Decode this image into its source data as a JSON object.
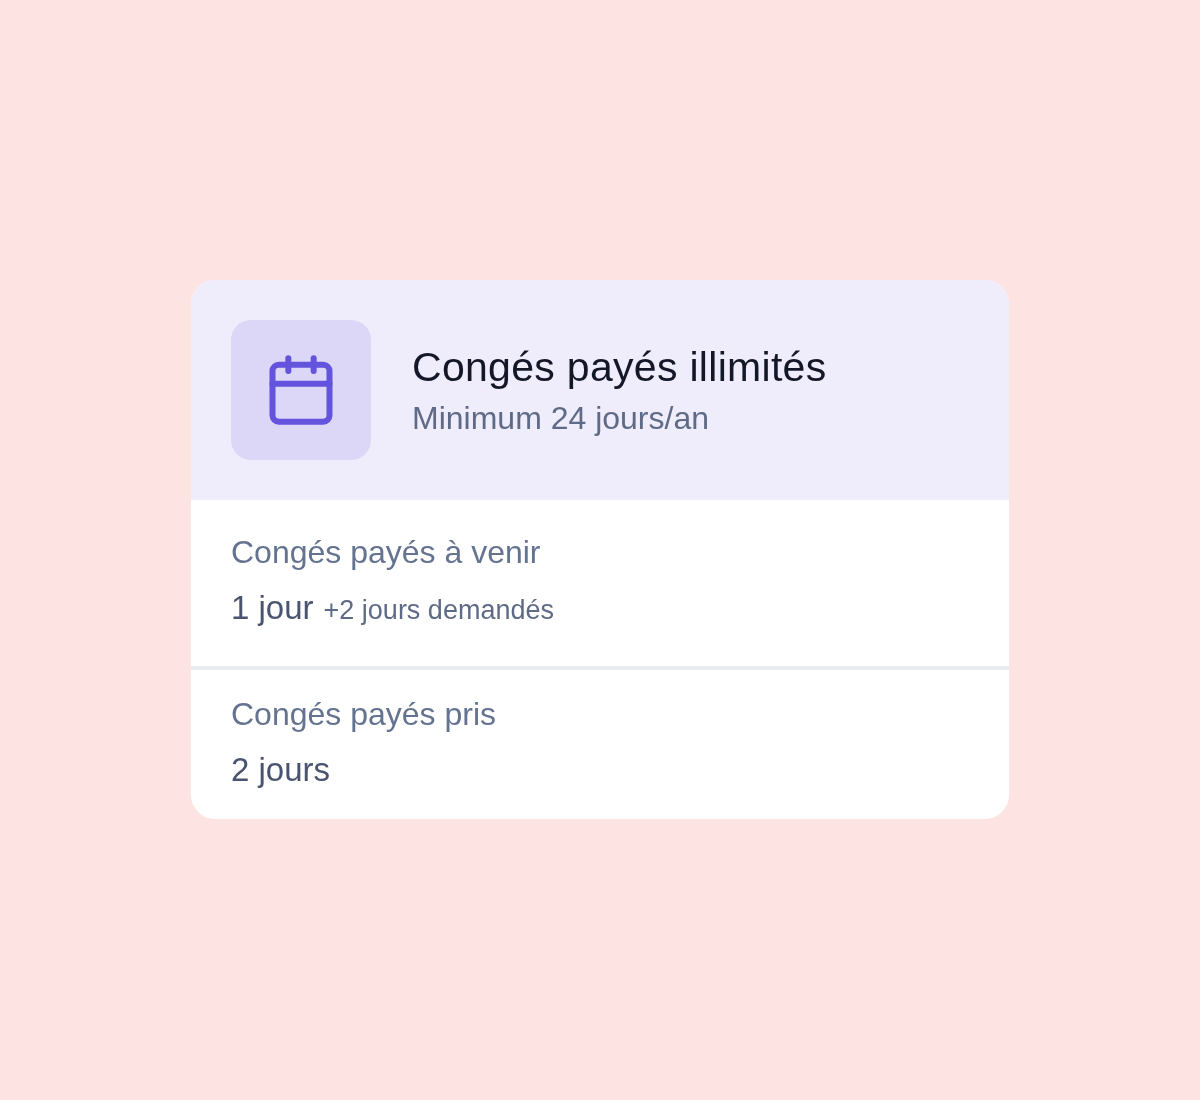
{
  "card": {
    "title": "Congés payés illimités",
    "subtitle": "Minimum 24 jours/an"
  },
  "rows": [
    {
      "label": "Congés payés à venir",
      "value": "1 jour",
      "note": "+2 jours demandés"
    },
    {
      "label": "Congés payés pris",
      "value": "2 jours"
    }
  ]
}
